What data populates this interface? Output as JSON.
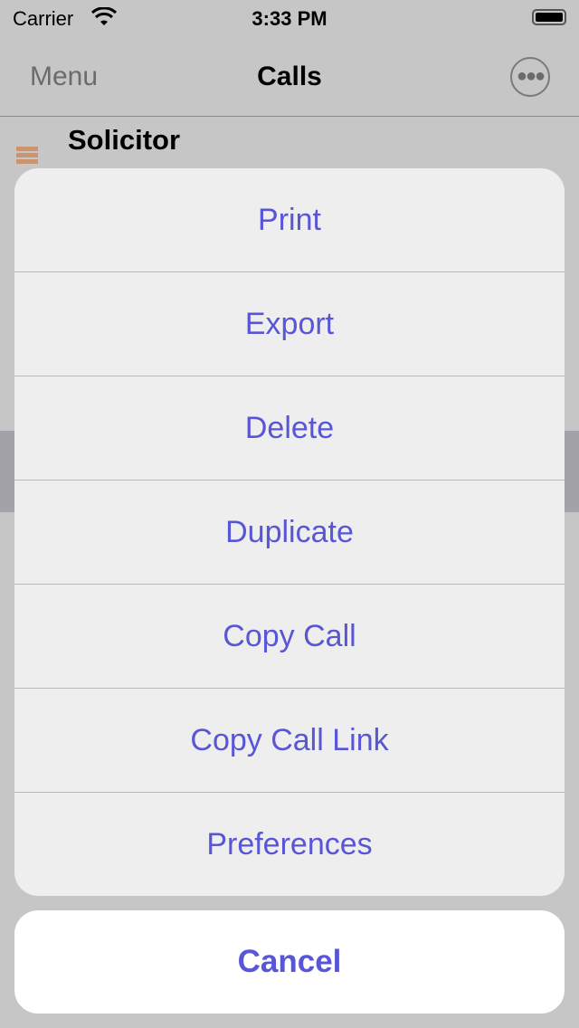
{
  "status_bar": {
    "carrier": "Carrier",
    "time": "3:33 PM",
    "wifi_icon": "wifi-icon",
    "battery_icon": "battery-icon"
  },
  "nav": {
    "left": "Menu",
    "title": "Calls",
    "more_icon": "ellipsis-circle-icon"
  },
  "list": {
    "first_row_title": "Solicitor",
    "handle_color": "#cb9471"
  },
  "action_sheet": {
    "items": [
      "Print",
      "Export",
      "Delete",
      "Duplicate",
      "Copy Call",
      "Copy Call Link",
      "Preferences"
    ],
    "cancel": "Cancel",
    "accent": "#5856d6"
  }
}
